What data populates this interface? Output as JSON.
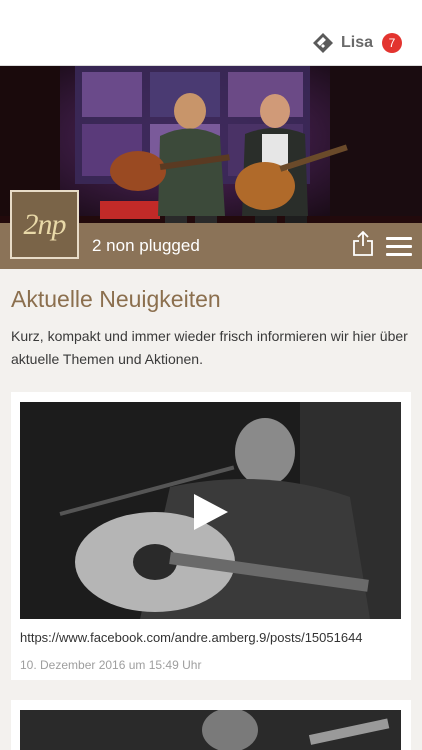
{
  "topbar": {
    "app_icon": "app-logo-icon",
    "user_name": "Lisa",
    "notification_count": "7"
  },
  "band": {
    "logo_text": "2np",
    "name": "2 non plugged",
    "share_icon": "share-icon",
    "menu_icon": "hamburger-menu-icon"
  },
  "section": {
    "title": "Aktuelle Neuigkeiten",
    "description": "Kurz, kompakt und immer wieder frisch informieren wir hier über aktuelle Themen und Aktionen."
  },
  "posts": [
    {
      "media": "video",
      "link": "https://www.facebook.com/andre.amberg.9/posts/15051644",
      "date": "10. Dezember 2016 um 15:49 Uhr"
    },
    {
      "media": "image"
    }
  ],
  "colors": {
    "accent": "#8b7358",
    "title": "#8b6f4e",
    "badge": "#e3342f",
    "background": "#f3f1ee"
  }
}
